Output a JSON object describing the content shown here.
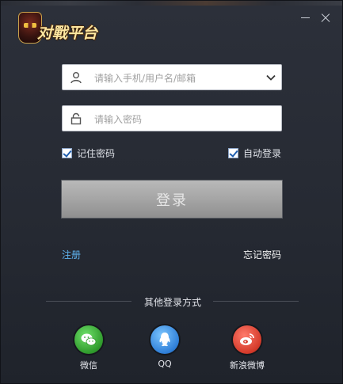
{
  "window": {
    "logo_text": "对戰平台",
    "minimize_icon": "minimize-icon",
    "close_icon": "close-icon"
  },
  "form": {
    "username_placeholder": "请输入手机/用户名/邮箱",
    "password_placeholder": "请输入密码",
    "remember_label": "记住密码",
    "remember_checked": true,
    "auto_login_label": "自动登录",
    "auto_login_checked": true,
    "login_button": "登录"
  },
  "links": {
    "register": "注册",
    "forgot": "忘记密码"
  },
  "other": {
    "label": "其他登录方式",
    "methods": [
      {
        "name": "微信",
        "icon": "wechat-icon",
        "color": "#2f9a2c"
      },
      {
        "name": "QQ",
        "icon": "qq-icon",
        "color": "#2f7fd8"
      },
      {
        "name": "新浪微博",
        "icon": "weibo-icon",
        "color": "#d43a2a"
      }
    ]
  },
  "colors": {
    "register_link": "#5fb3ef",
    "background": "#2a2e37"
  }
}
